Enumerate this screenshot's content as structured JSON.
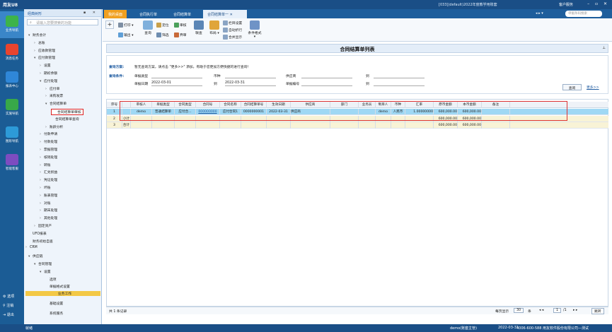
{
  "topbar": {
    "logo": "用友U8",
    "account": "[033](default)2022年度教学用账套",
    "service": "客户服务",
    "window_controls": "– ▫ ✕"
  },
  "leftnav": {
    "items": [
      {
        "label": "业务导航",
        "color": "#3db34a"
      },
      {
        "label": "消息任务",
        "color": "#e8442e"
      },
      {
        "label": "报表中心",
        "color": "#2f87d8"
      },
      {
        "label": "实施导航",
        "color": "#38a848"
      },
      {
        "label": "图形导航",
        "color": "#2d9ad8"
      },
      {
        "label": "智能客服",
        "color": "#7d4cc0"
      }
    ],
    "bottom": [
      {
        "icon": "⚙",
        "label": "选项"
      },
      {
        "icon": "⚲",
        "label": "注销"
      },
      {
        "icon": "⇥",
        "label": "退出"
      }
    ]
  },
  "tree": {
    "header": "经典树形",
    "header_controls": "▪ ✕",
    "search_placeholder": "请输入您要搜索的功能",
    "search_icon": "⌕",
    "nodes": [
      {
        "arrow": "▾",
        "label": "财务会计"
      },
      {
        "arrow": "›",
        "label": "总账"
      },
      {
        "arrow": "›",
        "label": "应收款管理"
      },
      {
        "arrow": "▾",
        "label": "应付款管理"
      },
      {
        "arrow": "›",
        "label": "设置"
      },
      {
        "arrow": "›",
        "label": "期初余额"
      },
      {
        "arrow": "▾",
        "label": "应付处理"
      },
      {
        "arrow": "›",
        "label": "应付单"
      },
      {
        "arrow": "›",
        "label": "采购发票"
      },
      {
        "arrow": "▾",
        "label": "合同结算单"
      },
      {
        "arrow": "",
        "label": "合同结算单审核"
      },
      {
        "arrow": "",
        "label": "合同结算单查询"
      },
      {
        "arrow": "›",
        "label": "账龄分析"
      },
      {
        "arrow": "›",
        "label": "付款申请"
      },
      {
        "arrow": "›",
        "label": "付款处理"
      },
      {
        "arrow": "›",
        "label": "票据管理"
      },
      {
        "arrow": "›",
        "label": "核销处理"
      },
      {
        "arrow": "›",
        "label": "转账"
      },
      {
        "arrow": "›",
        "label": "汇兑损益"
      },
      {
        "arrow": "›",
        "label": "凭证处理"
      },
      {
        "arrow": "›",
        "label": "坏账"
      },
      {
        "arrow": "›",
        "label": "账表管理"
      },
      {
        "arrow": "›",
        "label": "对账"
      },
      {
        "arrow": "›",
        "label": "期末处理"
      },
      {
        "arrow": "›",
        "label": "其他处理"
      },
      {
        "arrow": "›",
        "label": "固定资产"
      },
      {
        "arrow": "",
        "label": "UFO报表"
      },
      {
        "arrow": "",
        "label": "财务初始自查"
      },
      {
        "arrow": "›",
        "label": "CRM"
      },
      {
        "arrow": "▾",
        "label": "供应链"
      },
      {
        "arrow": "▾",
        "label": "合同管理"
      },
      {
        "arrow": "▾",
        "label": "设置"
      },
      {
        "arrow": "",
        "label": "选项"
      },
      {
        "arrow": "",
        "label": "单据格式设置"
      }
    ],
    "bottom": [
      {
        "label": "业务工作"
      },
      {
        "label": "基础设置"
      },
      {
        "label": "系统服务"
      }
    ]
  },
  "tabs": {
    "items": [
      "我的桌面",
      "合同执行单",
      "合同结算单",
      "合同结算单一"
    ],
    "right_controls": "◂ ▸ ▾",
    "search_placeholder": "单据条码搜索"
  },
  "toolbar": {
    "add": "+",
    "print": "打印",
    "export": "输出",
    "query": "查询",
    "locate": "定位",
    "filter": "筛选",
    "audit": "审核",
    "unaudit": "弃审",
    "layout": "栏目",
    "layout2": "联查",
    "layout3": "布局",
    "col_settings": "栏目设置",
    "auto_width": "自动折行",
    "merge": "合并显示",
    "cond_style": "条件格式"
  },
  "page_title": "合同结算单列表",
  "pin": "⊥",
  "query": {
    "scheme_label": "查询方案:",
    "scheme_text": "暂无查询方案，请点击 \"更多>>\" 添加，有助于您更加方便快捷的进行查询！",
    "cond_label": "查询条件:",
    "f_billtype": "单据类型",
    "f_currency": "币种",
    "f_supplier": "供应商",
    "f_to1": "到",
    "f_date": "单据日期",
    "date_from": "2022-03-01",
    "f_to2": "到",
    "date_to": "2022-03-31",
    "f_billno": "单据编号",
    "f_to3": "到",
    "btn_query": "查询",
    "more": "更多>>"
  },
  "grid": {
    "columns": [
      "序号",
      "",
      "审核人",
      "单据类型",
      "合同类型",
      "合同号",
      "合同名称",
      "合同结算单号",
      "生效日期",
      "供应商",
      "部门",
      "业务员",
      "制单人",
      "币种",
      "汇率",
      "原币金额",
      "本币金额",
      "备注"
    ],
    "rows": [
      [
        "1",
        "",
        "demo",
        "普通结算单",
        "应付合...",
        "000000000",
        "应付合同1",
        "0000000001",
        "2022-03-31",
        "供应商",
        "",
        "",
        "demo",
        "人民币",
        "1.00000000",
        "600,000.00",
        "600,000.00",
        ""
      ],
      [
        "2",
        "小计",
        "",
        "",
        "",
        "",
        "",
        "",
        "",
        "",
        "",
        "",
        "",
        "",
        "",
        "600,000.00",
        "600,000.00",
        ""
      ],
      [
        "3",
        "合计",
        "",
        "",
        "",
        "",
        "",
        "",
        "",
        "",
        "",
        "",
        "",
        "",
        "",
        "600,000.00",
        "600,000.00",
        ""
      ]
    ]
  },
  "footer": {
    "records": "共 1 条记录",
    "per_page_label": "每页显示",
    "per_page": "30",
    "per_page_unit": "条",
    "nav_prev": "◂ ◂",
    "page": "1",
    "page_total": "/1",
    "nav_next": "▸ ▸",
    "jump": "跳转"
  },
  "status": {
    "left": "就绪",
    "user": "demo(账套主管)",
    "date": "2022-03-31",
    "phone": "4006-600-588 用友软件股份有限公司—测试"
  }
}
